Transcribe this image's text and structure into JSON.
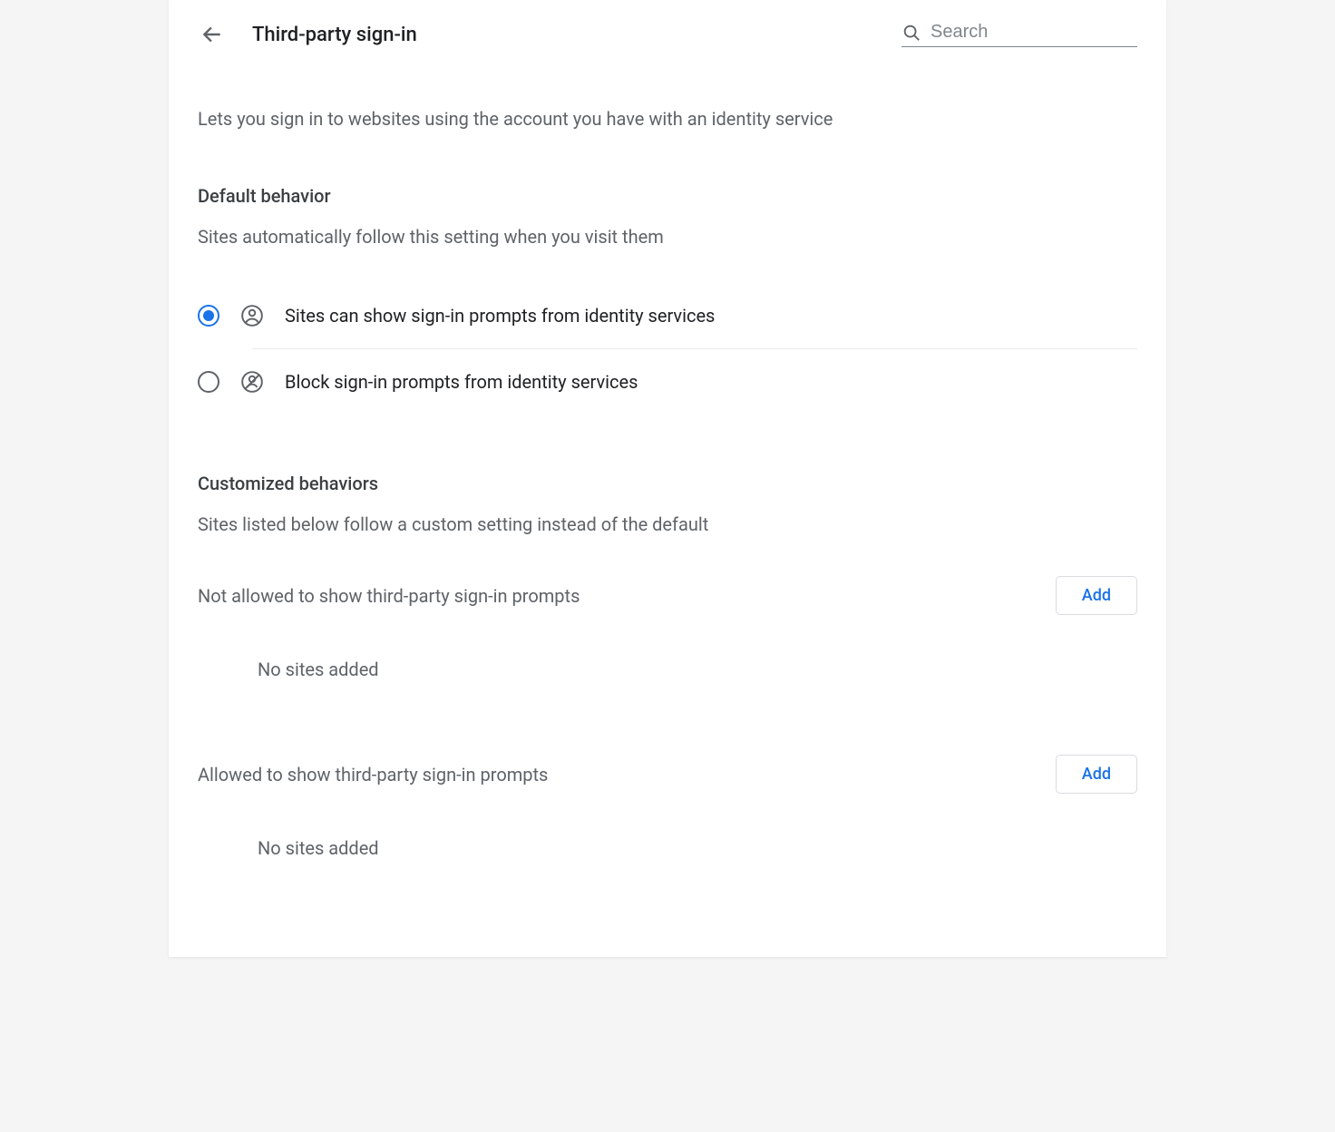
{
  "header": {
    "title": "Third-party sign-in",
    "search_placeholder": "Search"
  },
  "description": "Lets you sign in to websites using the account you have with an identity service",
  "default_section": {
    "heading": "Default behavior",
    "subheading": "Sites automatically follow this setting when you visit them",
    "options": [
      {
        "label": "Sites can show sign-in prompts from identity services",
        "selected": true
      },
      {
        "label": "Block sign-in prompts from identity services",
        "selected": false
      }
    ]
  },
  "custom_section": {
    "heading": "Customized behaviors",
    "subheading": "Sites listed below follow a custom setting instead of the default",
    "not_allowed": {
      "label": "Not allowed to show third-party sign-in prompts",
      "add_label": "Add",
      "empty_text": "No sites added"
    },
    "allowed": {
      "label": "Allowed to show third-party sign-in prompts",
      "add_label": "Add",
      "empty_text": "No sites added"
    }
  }
}
